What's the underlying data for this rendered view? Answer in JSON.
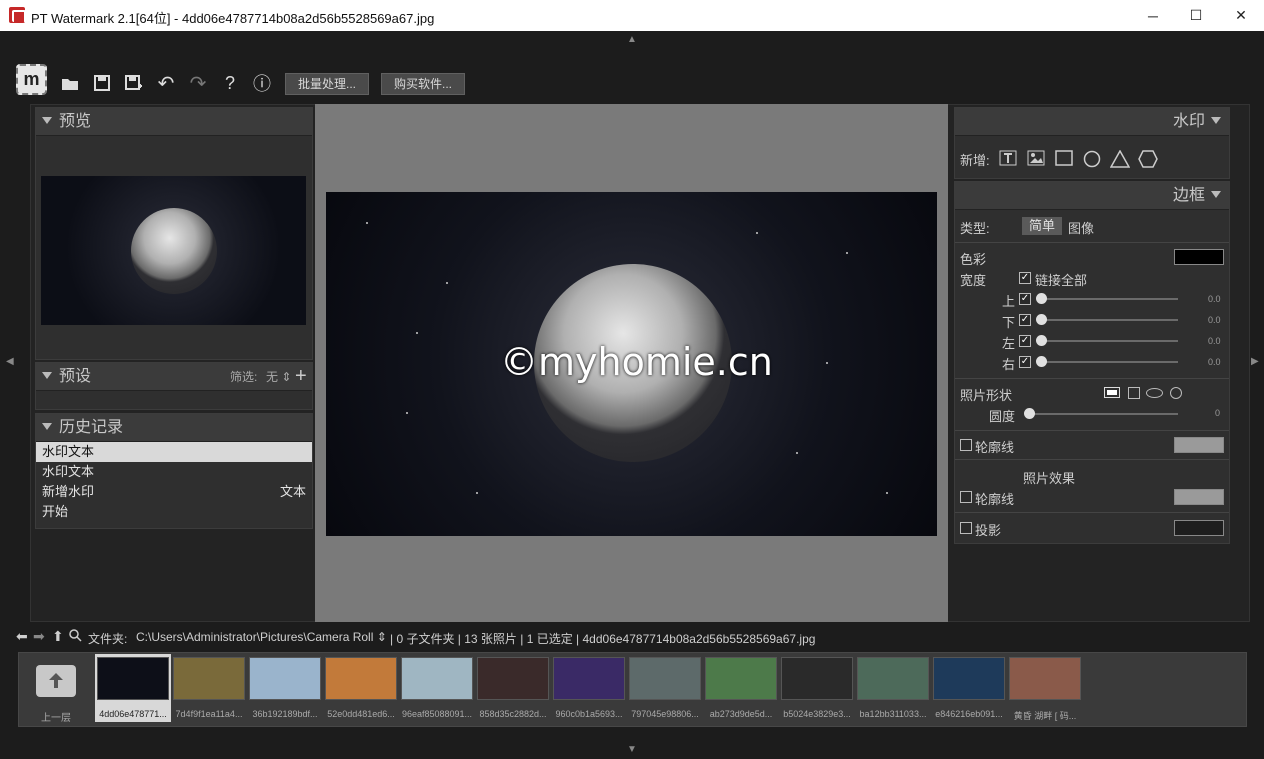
{
  "window": {
    "title": "PT Watermark 2.1[64位] - 4dd06e4787714b08a2d56b5528569a67.jpg",
    "minimize": "─",
    "maximize": "☐",
    "close": "✕"
  },
  "toolbar": {
    "logo": "m",
    "batch_label": "批量处理...",
    "buy_label": "购买软件...",
    "help": "?",
    "info": "ⓘ",
    "undo": "↶",
    "redo": "↷"
  },
  "left": {
    "preview": {
      "title": "预览"
    },
    "presets": {
      "title": "预设",
      "filter_label": "筛选:",
      "filter_value": "无",
      "add": "+"
    },
    "history": {
      "title": "历史记录",
      "items": [
        {
          "label": "水印文本",
          "right": "",
          "selected": true
        },
        {
          "label": "水印文本",
          "right": ""
        },
        {
          "label": "新增水印",
          "right": "文本"
        },
        {
          "label": "开始",
          "right": ""
        }
      ]
    }
  },
  "canvas": {
    "watermark_text": "©myhomie.cn"
  },
  "right": {
    "watermark": {
      "title": "水印",
      "add_label": "新增:"
    },
    "border": {
      "title": "边框",
      "type_label": "类型:",
      "type_simple": "简单",
      "type_image": "图像",
      "color_label": "色彩",
      "width_label": "宽度",
      "link_all": "链接全部",
      "sides": [
        {
          "label": "上",
          "value": "0.0"
        },
        {
          "label": "下",
          "value": "0.0"
        },
        {
          "label": "左",
          "value": "0.0"
        },
        {
          "label": "右",
          "value": "0.0"
        }
      ],
      "shape_label": "照片形状",
      "round_label": "圆度",
      "round_value": "0",
      "outline_label": "轮廓线",
      "effect_title": "照片效果",
      "effect_outline_label": "轮廓线",
      "shadow_label": "投影",
      "colors": {
        "border": "#000000",
        "outline": "#9a9a9a",
        "effect_outline": "#9a9a9a",
        "shadow": "#1e1e1e"
      }
    }
  },
  "status": {
    "folder_label": "文件夹:",
    "path": "C:\\Users\\Administrator\\Pictures\\Camera Roll",
    "info": "| 0 子文件夹 | 13 张照片 | 1 已选定 | 4dd06e4787714b08a2d56b5528569a67.jpg"
  },
  "filmstrip": {
    "up_label": "上一层",
    "items": [
      {
        "label": "4dd06e478771...",
        "color": "#0d0f18",
        "selected": true
      },
      {
        "label": "7d4f9f1ea11a4...",
        "color": "#7a6a3a"
      },
      {
        "label": "36b192189bdf...",
        "color": "#9ab4cc"
      },
      {
        "label": "52e0dd481ed6...",
        "color": "#c27a3a"
      },
      {
        "label": "96eaf85088091...",
        "color": "#9fb6c2"
      },
      {
        "label": "858d35c2882d...",
        "color": "#3a2a2a"
      },
      {
        "label": "960c0b1a5693...",
        "color": "#3a2a66"
      },
      {
        "label": "797045e98806...",
        "color": "#5d6a6a"
      },
      {
        "label": "ab273d9de5d...",
        "color": "#4d7a4a"
      },
      {
        "label": "b5024e3829e3...",
        "color": "#2a2a2a"
      },
      {
        "label": "ba12bb311033...",
        "color": "#4d6a5a"
      },
      {
        "label": "e846216eb091...",
        "color": "#1e3a5a"
      },
      {
        "label": "黄昏 湖畔 [ 码...",
        "color": "#8a5a4a"
      }
    ]
  }
}
